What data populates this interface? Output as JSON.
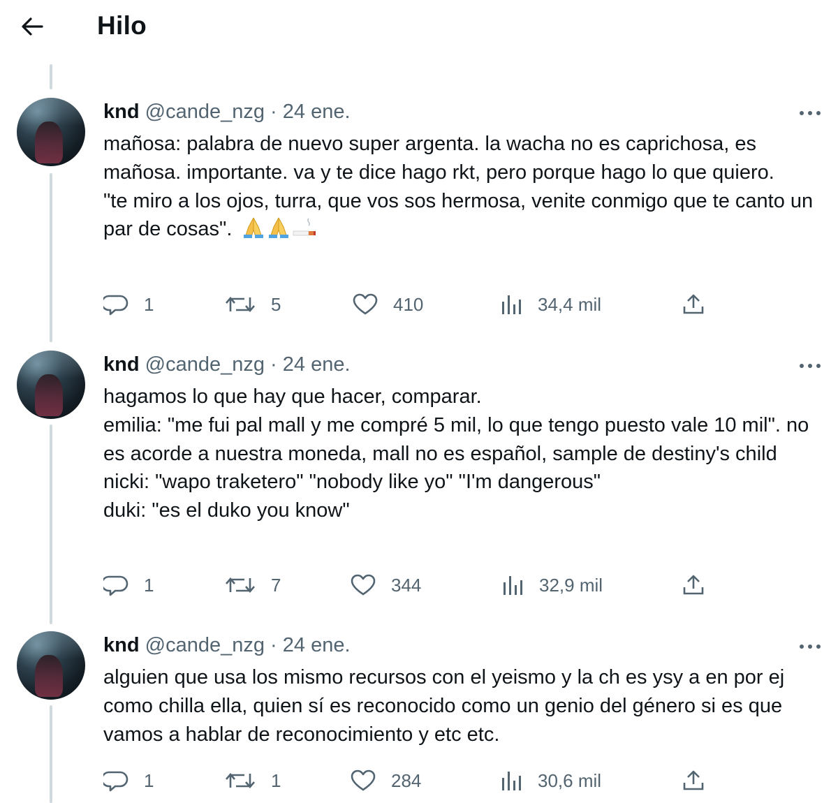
{
  "header": {
    "back_icon": "arrow-left-icon",
    "title": "Hilo"
  },
  "colors": {
    "text": "#0f1419",
    "secondary": "#536471",
    "thread_line": "#cfd9de",
    "background": "#ffffff"
  },
  "tweets": [
    {
      "author_name": "knd",
      "handle": "@cande_nzg",
      "separator": "·",
      "date": "24 ene.",
      "lines": [
        "mañosa: palabra de nuevo super argenta. la wacha no es caprichosa, es mañosa. importante. va y te dice hago rkt, pero porque hago lo que quiero.",
        "\"te miro a los ojos, turra, que vos sos hermosa, venite conmigo que te canto un par de cosas\"."
      ],
      "emojis": [
        "folded-hands-icon",
        "folded-hands-icon",
        "smoking-icon"
      ],
      "replies": "1",
      "retweets": "5",
      "likes": "410",
      "views": "34,4 mil"
    },
    {
      "author_name": "knd",
      "handle": "@cande_nzg",
      "separator": "·",
      "date": "24 ene.",
      "lines": [
        "hagamos lo que hay que hacer, comparar.",
        "emilia: \"me fui pal mall y me compré 5 mil, lo que tengo puesto vale 10 mil\". no es acorde a nuestra moneda, mall no es español, sample de destiny's child",
        "nicki: \"wapo traketero\" \"nobody like yo\" \"I'm dangerous\"",
        "duki: \"es el duko you know\""
      ],
      "replies": "1",
      "retweets": "7",
      "likes": "344",
      "views": "32,9 mil"
    },
    {
      "author_name": "knd",
      "handle": "@cande_nzg",
      "separator": "·",
      "date": "24 ene.",
      "lines": [
        "alguien que usa los mismo recursos con el yeismo y la ch es ysy a en por ej como chilla ella, quien sí es reconocido como un genio del género si es que vamos a hablar de reconocimiento y etc etc."
      ],
      "replies": "1",
      "retweets": "1",
      "likes": "284",
      "views": "30,6 mil"
    }
  ]
}
